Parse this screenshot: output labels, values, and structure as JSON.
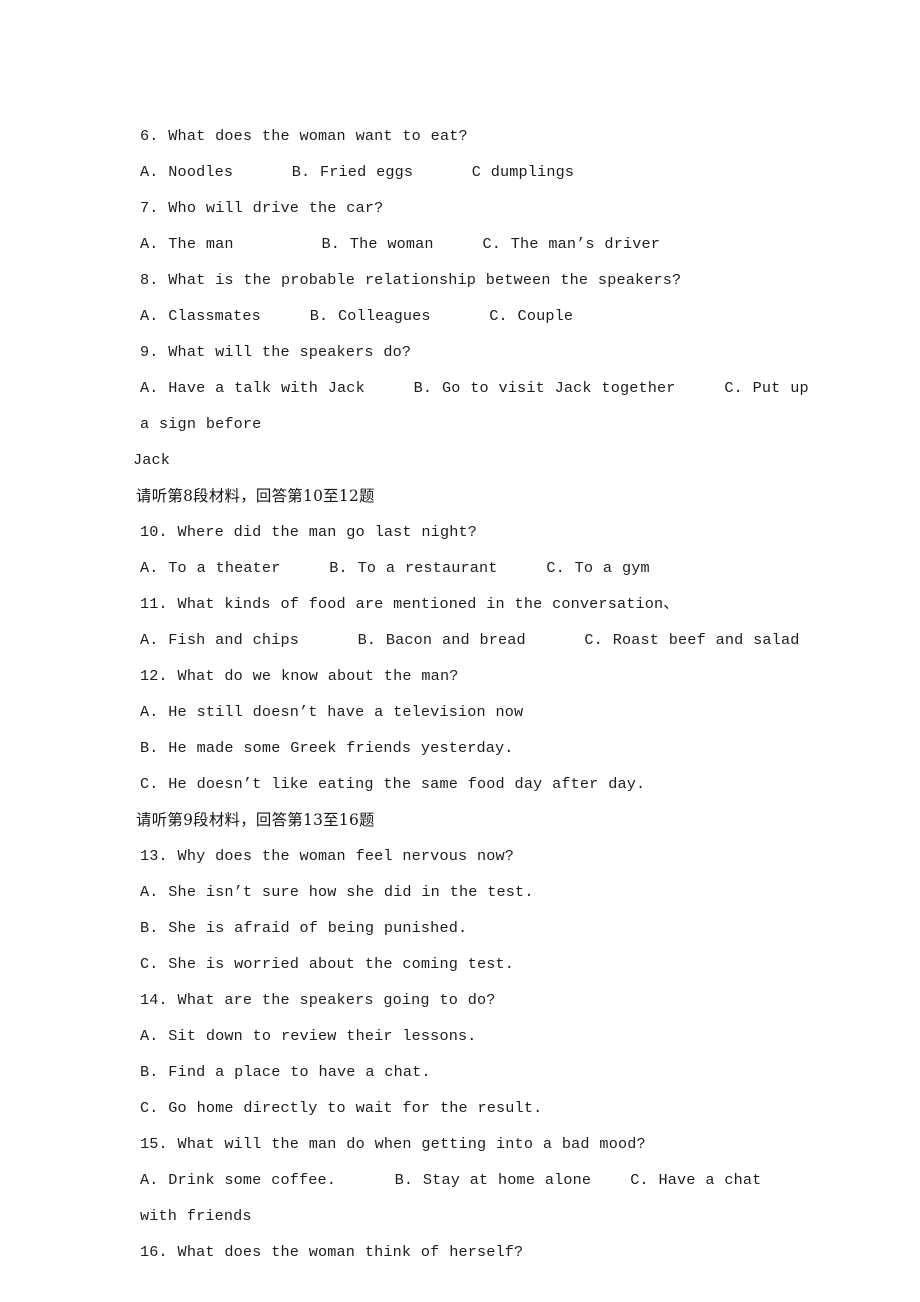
{
  "document": {
    "type": "exam-paper",
    "language": "en-CN",
    "section": "listening-comprehension",
    "background_color": "#ffffff",
    "text_color": "#1d1d1d"
  },
  "lines": {
    "q6_stem": "6. What does the woman want to eat?",
    "q6_options": "A. Noodles      B. Fried eggs      C dumplings",
    "q7_stem": "7. Who will drive the car?",
    "q7_options": "A. The man         B. The woman     C. The man’s driver",
    "q8_stem": "8. What is the probable relationship between the speakers?",
    "q8_options": "A. Classmates     B. Colleagues      C. Couple",
    "q9_stem": "9. What will the speakers do?",
    "q9_options": "A. Have a talk with Jack     B. Go to visit Jack together     C. Put up a sign before",
    "q9_options_wrap": "Jack",
    "heading_8": "请听第8段材料，回答第10至12题",
    "q10_stem": "10. Where did the man go last night?",
    "q10_options": "A. To a theater     B. To a restaurant     C. To a gym",
    "q11_stem": "11. What kinds of food are mentioned in the conversation、",
    "q11_options": "A. Fish and chips      B. Bacon and bread      C. Roast beef and salad",
    "q12_stem": "12. What do we know about the man?",
    "q12_option_a": "A. He still doesn’t have a television now",
    "q12_option_b": "B. He made some Greek friends yesterday.",
    "q12_option_c": "C. He doesn’t like eating the same food day after day.",
    "heading_9": "请听第9段材料，回答第13至16题",
    "q13_stem": "13. Why does the woman feel nervous now?",
    "q13_option_a": "A. She isn’t sure how she did in the test.",
    "q13_option_b": "B. She is afraid of being punished.",
    "q13_option_c": "C. She is worried about the coming test.",
    "q14_stem": "14. What are the speakers going to do?",
    "q14_option_a": "A. Sit down to review their lessons.",
    "q14_option_b": "B. Find a place to have a chat.",
    "q14_option_c": "C. Go home directly to wait for the result.",
    "q15_stem": "15. What will the man do when getting into a bad mood?",
    "q15_options": "A. Drink some coffee.      B. Stay at home alone    C. Have a chat with friends",
    "q16_stem": "16. What does the woman think of herself?"
  }
}
